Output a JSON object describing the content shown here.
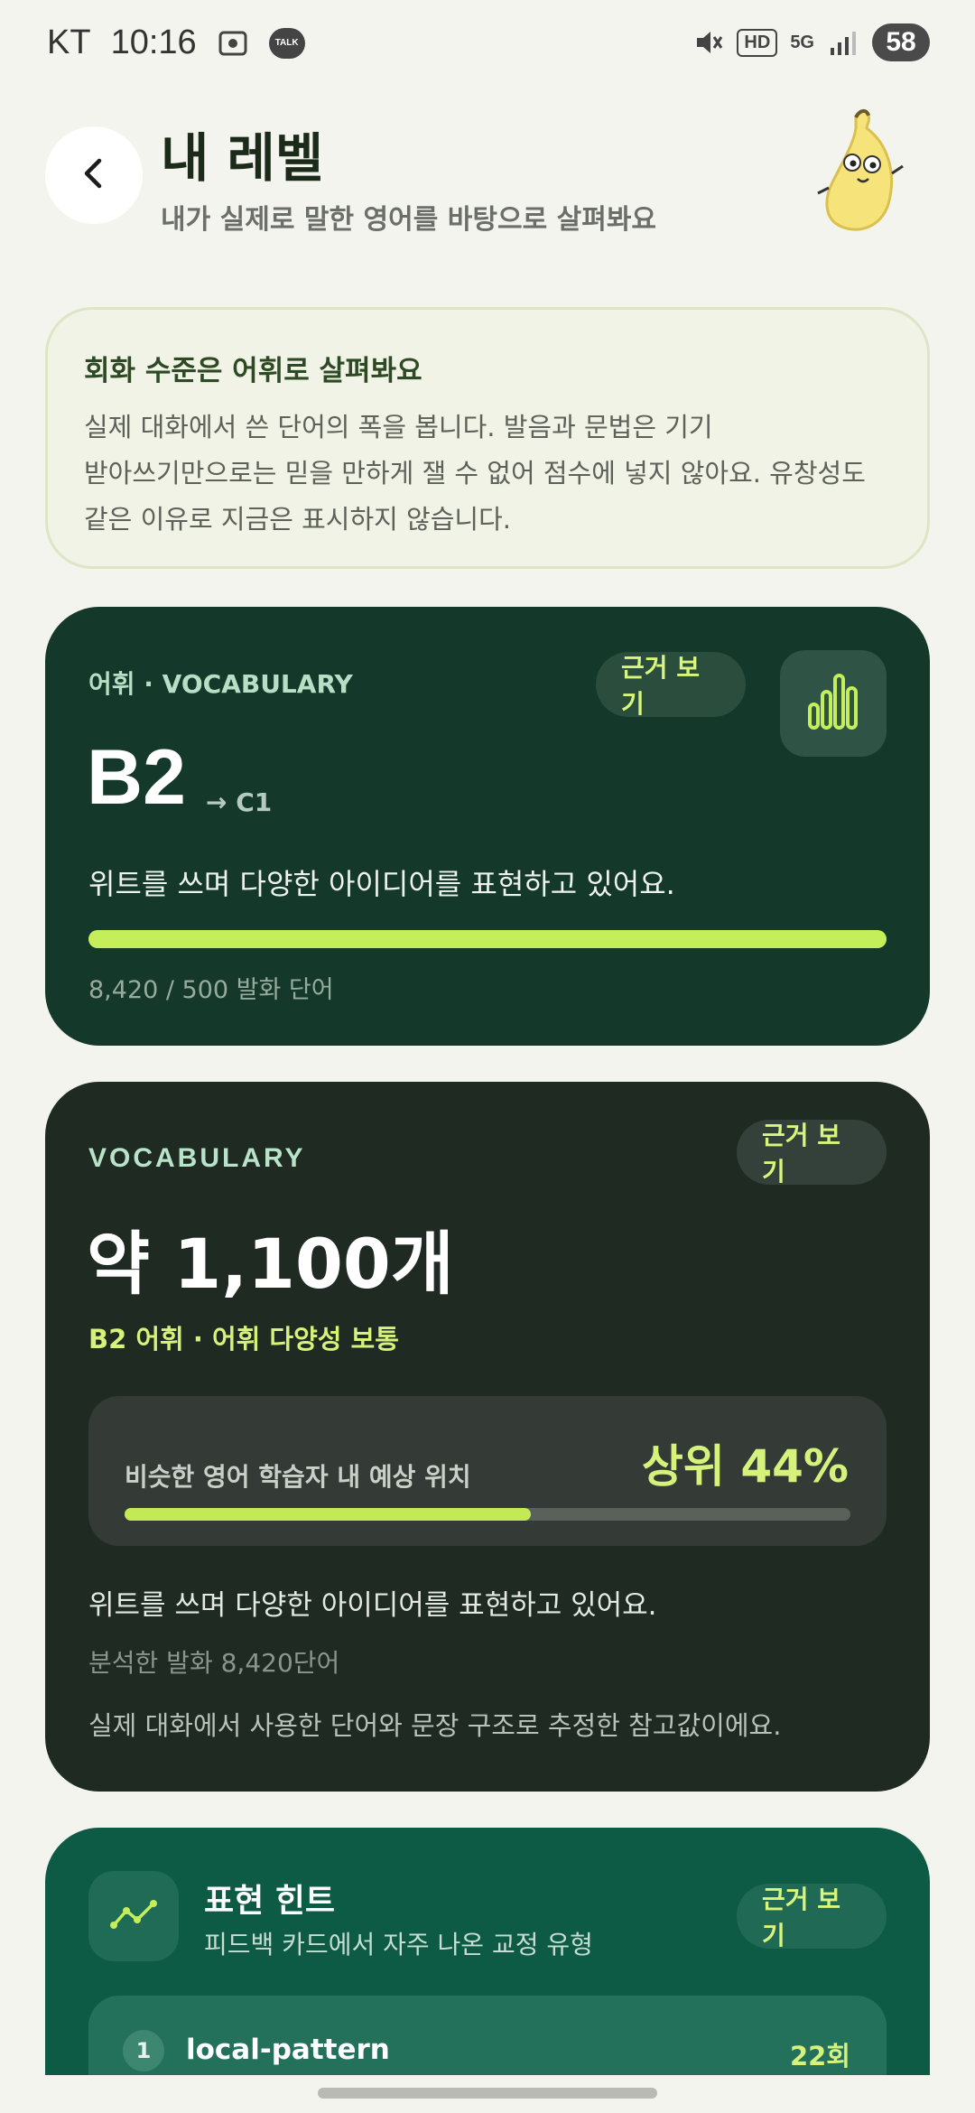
{
  "status_bar": {
    "carrier": "KT",
    "time": "10:16",
    "talk_label": "TALK",
    "hd_label": "HD",
    "network": "5G",
    "battery": "58"
  },
  "header": {
    "title": "내 레벨",
    "subtitle": "내가 실제로 말한 영어를 바탕으로 살펴봐요"
  },
  "info_card": {
    "title": "회화 수준은 어휘로 살펴봐요",
    "body_lines": [
      "실제 대화에서 쓴 단어의 폭을 봅니다. 발음과 문법은 기기",
      "받아쓰기만으로는 믿을 만하게 잴 수 없어 점수에 넣지 않아요. 유창성도",
      "같은 이유로 지금은 표시하지 않습니다."
    ]
  },
  "vocab_card": {
    "label": "어휘 · VOCABULARY",
    "evidence_button": "근거 보기",
    "level": "B2",
    "next_level": "→ C1",
    "description": "위트를 쓰며 다양한 아이디어를 표현하고 있어요.",
    "progress": 1.0,
    "count_text": "8,420 / 500 발화 단어"
  },
  "vocab_detail_card": {
    "label": "VOCABULARY",
    "evidence_button": "근거 보기",
    "estimate": "약 1,100개",
    "sublabel": "B2 어휘 · 어휘 다양성 보통",
    "rank_label": "비슷한 영어 학습자 내 예상 위치",
    "rank_value": "상위 44%",
    "rank_progress": 0.56,
    "description": "위트를 쓰며 다양한 아이디어를 표현하고 있어요.",
    "analyzed": "분석한 발화 8,420단어",
    "note": "실제 대화에서 사용한 단어와 문장 구조로 추정한 참고값이에요."
  },
  "hint_card": {
    "title": "표현 힌트",
    "subtitle": "피드백 카드에서 자주 나온 교정 유형",
    "evidence_button": "근거 보기",
    "items": [
      {
        "rank": "1",
        "pattern": "local-pattern",
        "count": "22회"
      }
    ]
  },
  "colors": {
    "background": "#f4f4ef",
    "vocab_card": "#14382a",
    "detail_card": "#1f2a22",
    "hint_card": "#0d5a45",
    "accent_lime": "#c5ef5a"
  }
}
